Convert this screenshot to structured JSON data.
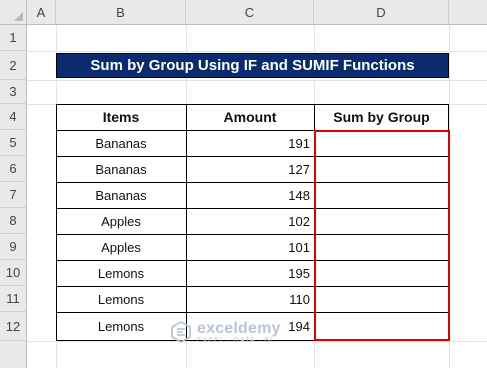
{
  "sheet": {
    "columns": [
      "A",
      "B",
      "C",
      "D"
    ],
    "rows": [
      "1",
      "2",
      "3",
      "4",
      "5",
      "6",
      "7",
      "8",
      "9",
      "10",
      "11",
      "12"
    ]
  },
  "title": "Sum by Group Using IF and SUMIF Functions",
  "table": {
    "headers": [
      "Items",
      "Amount",
      "Sum by Group"
    ],
    "rows": [
      {
        "item": "Bananas",
        "amount": "191",
        "sum": ""
      },
      {
        "item": "Bananas",
        "amount": "127",
        "sum": ""
      },
      {
        "item": "Bananas",
        "amount": "148",
        "sum": ""
      },
      {
        "item": "Apples",
        "amount": "102",
        "sum": ""
      },
      {
        "item": "Apples",
        "amount": "101",
        "sum": ""
      },
      {
        "item": "Lemons",
        "amount": "195",
        "sum": ""
      },
      {
        "item": "Lemons",
        "amount": "110",
        "sum": ""
      },
      {
        "item": "Lemons",
        "amount": "194",
        "sum": ""
      }
    ]
  },
  "highlight_color": "#e00000",
  "header_fill_color": "#0a2b6e",
  "watermark": {
    "name": "exceldemy",
    "tagline": "EXCEL · DATA · BI",
    "icon": "exceldemy-logo-icon"
  }
}
